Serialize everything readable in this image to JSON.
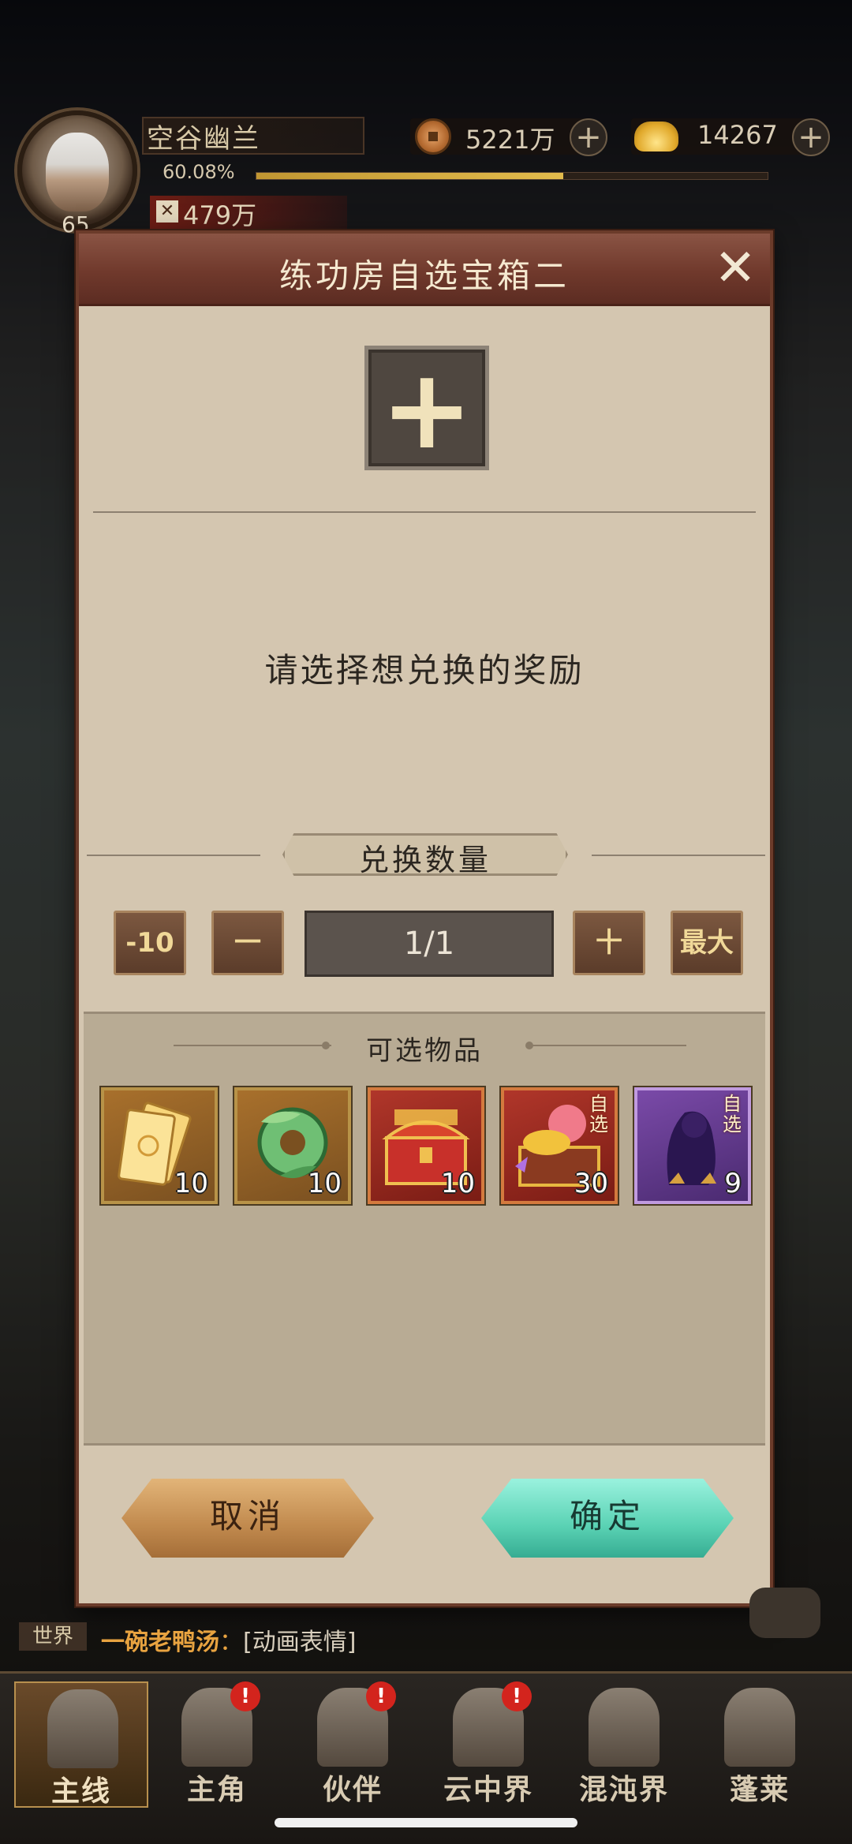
{
  "hud": {
    "player_name": "空谷幽兰",
    "level": "65",
    "exp_percent": "60.08%",
    "exp_fill": 0.6,
    "power": "479万",
    "copper": "5221万",
    "gold": "14267"
  },
  "dialog": {
    "title": "练功房自选宝箱二",
    "prompt": "请选择想兑换的奖励",
    "qty_label": "兑换数量",
    "minus10": "-10",
    "minus": "一",
    "quantity": "1/1",
    "plus": "十",
    "max": "最大",
    "items_title": "可选物品",
    "items": [
      {
        "icon": "gold-ticket-icon",
        "count": "10",
        "tag": ""
      },
      {
        "icon": "jade-pendant-icon",
        "count": "10",
        "tag": ""
      },
      {
        "icon": "red-treasure-chest-icon",
        "count": "10",
        "tag": ""
      },
      {
        "icon": "gold-treasure-chest-icon",
        "count": "30",
        "tag": "自选"
      },
      {
        "icon": "shadow-character-icon",
        "count": "9",
        "tag": "自选"
      }
    ],
    "cancel": "取消",
    "confirm": "确定"
  },
  "chat": [
    {
      "channel": "世界",
      "sender": "一碗老鸭汤",
      "message": "[动画表情]"
    }
  ],
  "nav": [
    {
      "label": "主线",
      "badge": ""
    },
    {
      "label": "主角",
      "badge": "!"
    },
    {
      "label": "伙伴",
      "badge": "!"
    },
    {
      "label": "云中界",
      "badge": "!"
    },
    {
      "label": "混沌界",
      "badge": ""
    },
    {
      "label": "蓬莱",
      "badge": ""
    }
  ],
  "colors": {
    "dialog_bg": "#d4c6b0",
    "header": "#70392c",
    "confirm": "#5ad2b4",
    "cancel": "#c18a4e"
  }
}
